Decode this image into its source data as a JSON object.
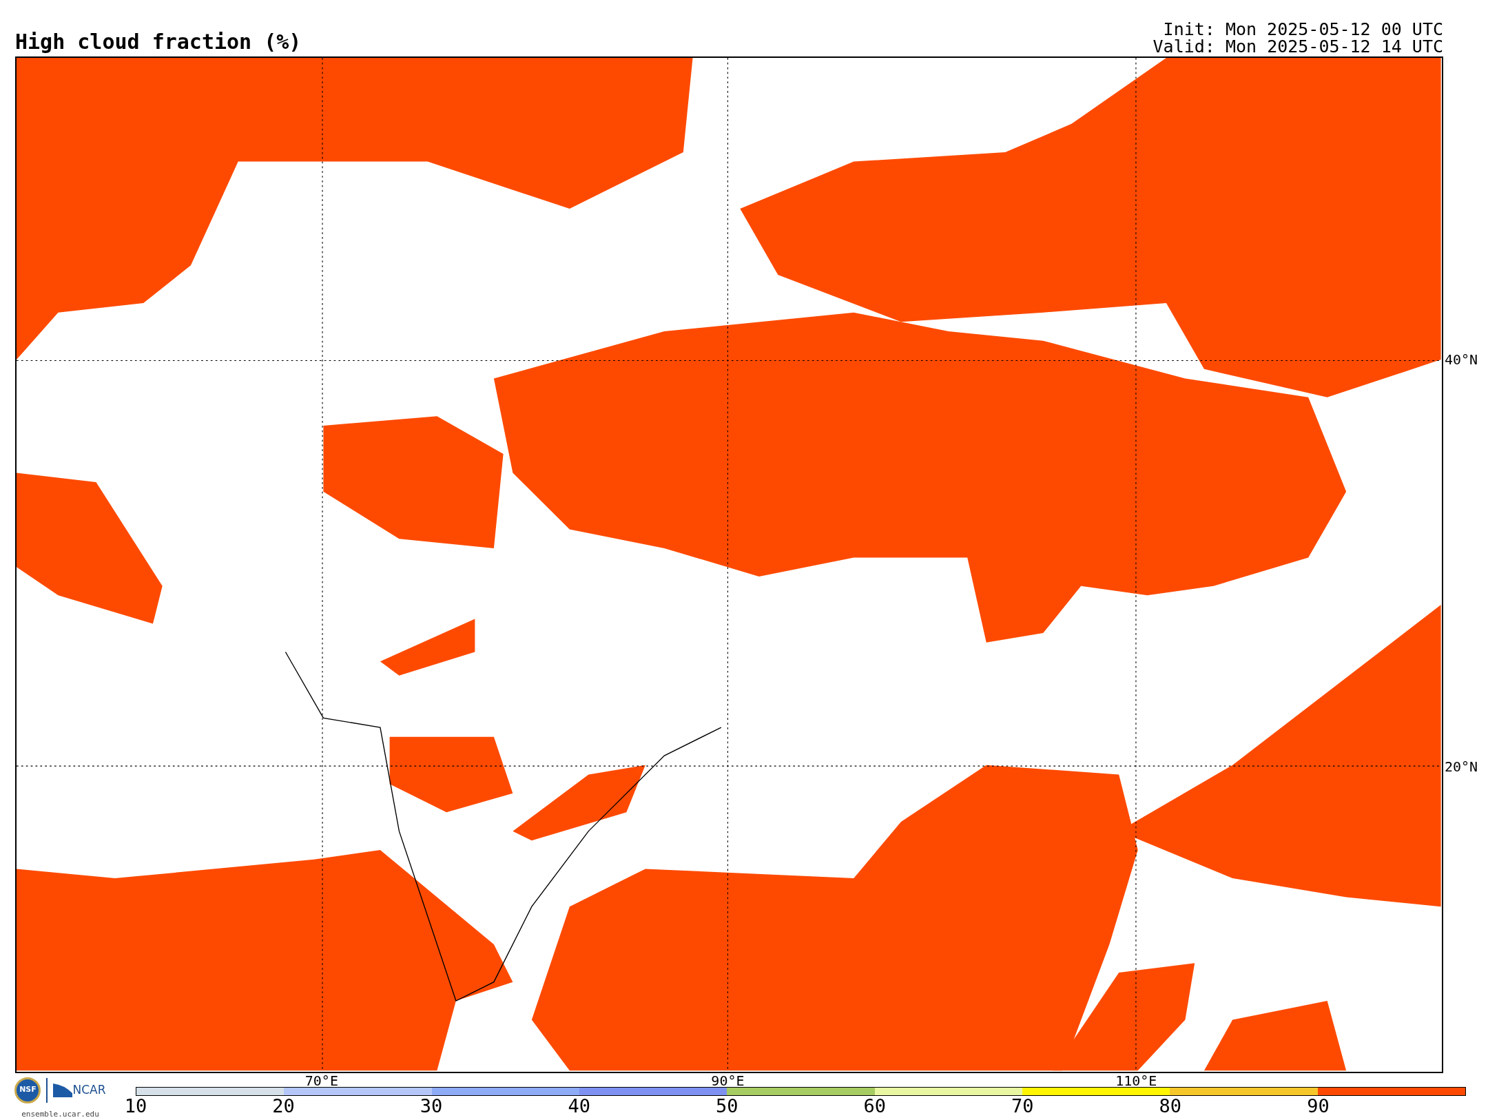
{
  "title": "High cloud fraction (%)",
  "init": "Init: Mon 2025-05-12 00 UTC",
  "valid": "Valid: Mon 2025-05-12 14 UTC",
  "map": {
    "lon_labels": [
      "70°E",
      "90°E",
      "110°E"
    ],
    "lat_labels": [
      "40°N",
      "20°N"
    ]
  },
  "logos": {
    "nsf": "NSF",
    "ncar": "NCAR",
    "url": "ensemble.ucar.edu"
  },
  "colorbar": {
    "segments": [
      {
        "color": "#d5e0e8"
      },
      {
        "color": "#b4c7f8"
      },
      {
        "color": "#8eabf6"
      },
      {
        "color": "#7f91f0"
      },
      {
        "color": "#a6cc62"
      },
      {
        "color": "#e9f6a2"
      },
      {
        "color": "#fff500"
      },
      {
        "color": "#f6c72b"
      },
      {
        "color": "#fe4a00"
      }
    ],
    "ticks": [
      "10",
      "20",
      "30",
      "40",
      "50",
      "60",
      "70",
      "80",
      "90"
    ]
  }
}
